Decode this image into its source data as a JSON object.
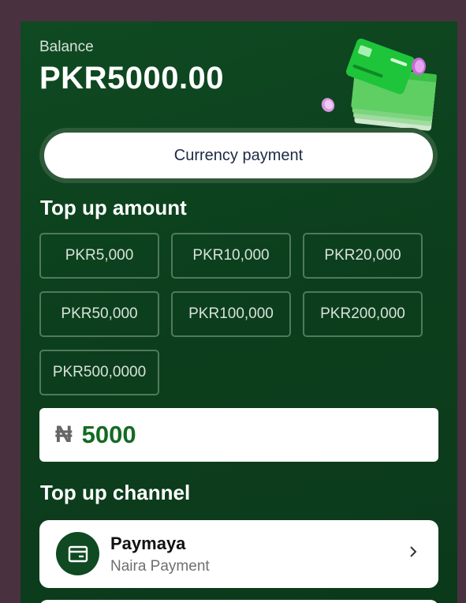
{
  "balance": {
    "label": "Balance",
    "value": "PKR5000.00"
  },
  "currency_payment": {
    "label": "Currency payment"
  },
  "topup_amount": {
    "title": "Top up amount",
    "options": [
      "PKR5,000",
      "PKR10,000",
      "PKR20,000",
      "PKR50,000",
      "PKR100,000",
      "PKR200,000",
      "PKR500,0000"
    ]
  },
  "amount_input": {
    "currency_symbol": "₦",
    "value": "5000"
  },
  "topup_channel": {
    "title": "Top up channel",
    "channels": [
      {
        "name": "Paymaya",
        "subtitle": "Naira Payment",
        "icon": "wallet-icon"
      }
    ]
  },
  "colors": {
    "panel": "#0f4a22",
    "accent": "#136b22",
    "backdrop": "#4a3140"
  }
}
